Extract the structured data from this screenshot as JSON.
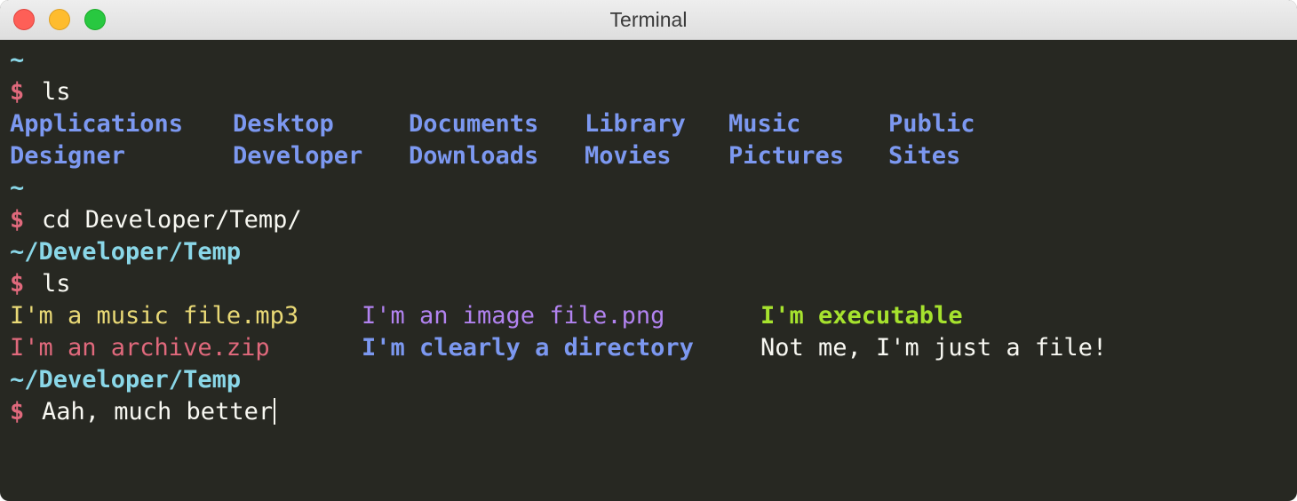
{
  "window": {
    "title": "Terminal"
  },
  "terminal": {
    "home_prompt": "~",
    "dollar": "$",
    "cmd_ls": "ls",
    "home_entries": {
      "row1": [
        "Applications",
        "Desktop",
        "Documents",
        "Library",
        "Music",
        "Public"
      ],
      "row2": [
        "Designer",
        "Developer",
        "Downloads",
        "Movies",
        "Pictures",
        "Sites"
      ]
    },
    "cmd_cd": "cd Developer/Temp/",
    "temp_path": "~/Developer/Temp",
    "temp_entries": {
      "row1": [
        "I'm a music file.mp3",
        "I'm an image file.png",
        "I'm executable"
      ],
      "row2": [
        "I'm an archive.zip",
        "I'm clearly a directory",
        "Not me, I'm just a file!"
      ]
    },
    "current_input": "Aah, much better"
  },
  "colors": {
    "background": "#272822",
    "prompt_dollar": "#e0697c",
    "path": "#8ad7e8",
    "directory": "#7c98f0",
    "audio_file": "#e9d976",
    "image_file": "#b283f0",
    "executable": "#a6e22e",
    "archive": "#e0697c",
    "plain_text": "#f8f8f2"
  }
}
